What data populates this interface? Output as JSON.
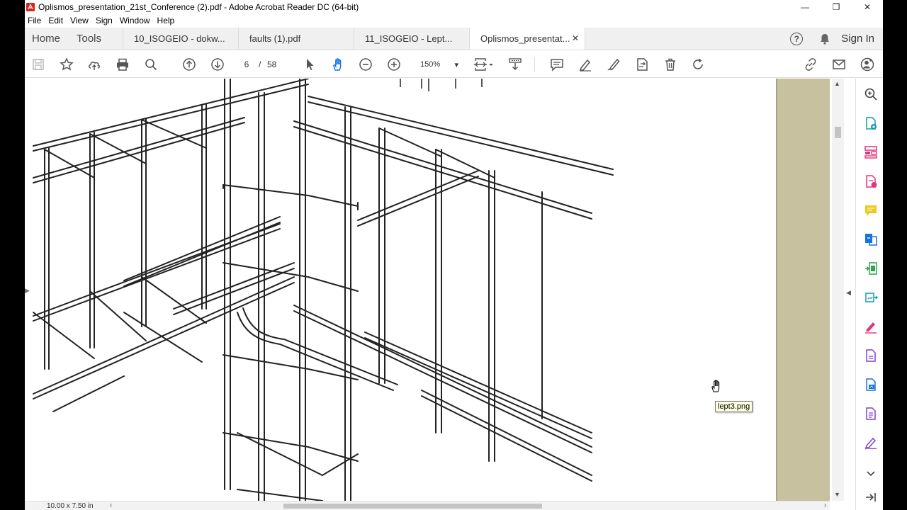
{
  "window": {
    "title": "Oplismos_presentation_21st_Conference (2).pdf - Adobe Acrobat Reader DC (64-bit)",
    "controls": {
      "minimize": "—",
      "restore": "❐",
      "close": "✕"
    }
  },
  "menu": [
    "File",
    "Edit",
    "View",
    "Sign",
    "Window",
    "Help"
  ],
  "nav": {
    "home": "Home",
    "tools": "Tools"
  },
  "tabs": [
    {
      "label": "10_ISOGEIO - dokw...",
      "active": false
    },
    {
      "label": "faults (1).pdf",
      "active": false
    },
    {
      "label": "11_ISOGEIO - Lept...",
      "active": false
    },
    {
      "label": "Oplismos_presentat...",
      "active": true,
      "close": "✕"
    }
  ],
  "header_right": {
    "help": "?",
    "sign_in": "Sign In"
  },
  "toolbar": {
    "page_current": "6",
    "page_separator": "/",
    "page_total": "58",
    "zoom": "150%",
    "zoom_arrow": "▾"
  },
  "status": {
    "page_size": "10.00 x 7.50 in"
  },
  "tooltip": "lept3.png",
  "colors": {
    "accent_blue": "#1473e6",
    "tool_pink": "#e2347a",
    "tool_green": "#2da44e",
    "tool_yellow": "#f5c518",
    "tool_teal": "#0d9ea8",
    "tool_purple": "#7b46c9",
    "doc_background": "#c8c1a0"
  },
  "right_tools": [
    "search-zoom-icon",
    "create-pdf-icon",
    "organize-pages-icon",
    "export-pdf-icon",
    "comment-icon",
    "combine-files-icon",
    "compress-pdf-icon",
    "send-for-signature-icon",
    "fill-sign-icon",
    "protect-icon",
    "scan-icon",
    "more-tools-icon",
    "fill-sign-pen-icon",
    "expand-down-icon",
    "collapse-right-icon"
  ]
}
